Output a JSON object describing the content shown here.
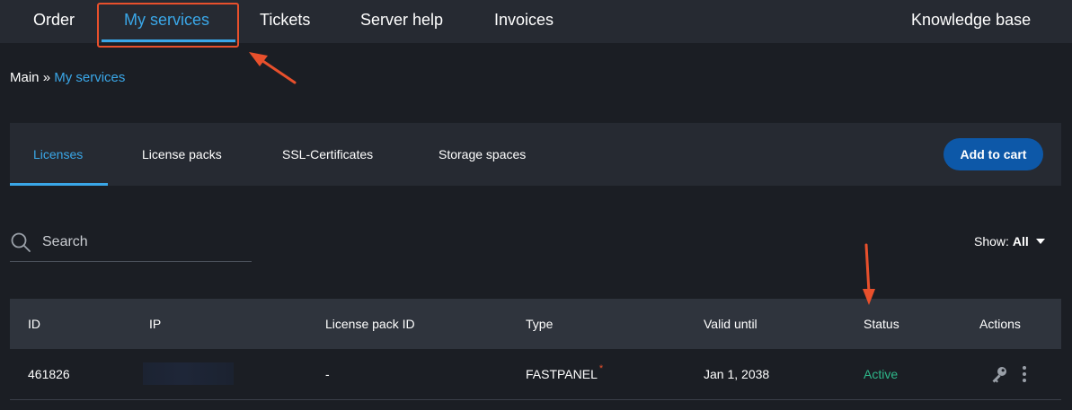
{
  "topnav": {
    "items": [
      {
        "label": "Order"
      },
      {
        "label": "My services"
      },
      {
        "label": "Tickets"
      },
      {
        "label": "Server help"
      },
      {
        "label": "Invoices"
      }
    ],
    "knowledge_base": "Knowledge base"
  },
  "breadcrumb": {
    "root": "Main",
    "separator": "»",
    "current": "My services"
  },
  "tabs": {
    "items": [
      {
        "label": "Licenses"
      },
      {
        "label": "License packs"
      },
      {
        "label": "SSL-Certificates"
      },
      {
        "label": "Storage spaces"
      }
    ],
    "add_to_cart": "Add to cart"
  },
  "search": {
    "placeholder": "Search",
    "value": ""
  },
  "filter": {
    "label": "Show:",
    "value": "All"
  },
  "table": {
    "columns": [
      "ID",
      "IP",
      "License pack ID",
      "Type",
      "Valid until",
      "Status",
      "Actions"
    ],
    "rows": [
      {
        "id": "461826",
        "ip": "",
        "license_pack_id": "-",
        "type": "FASTPANEL",
        "type_marker": "*",
        "valid_until": "Jan 1, 2038",
        "status": "Active",
        "actions": [
          "key-icon",
          "kebab-menu-icon"
        ]
      }
    ]
  },
  "colors": {
    "accent": "#3aa7e8",
    "button": "#0d58a8",
    "status_active": "#2eb88a",
    "annotation": "#e8502c",
    "background": "#1b1e24"
  }
}
